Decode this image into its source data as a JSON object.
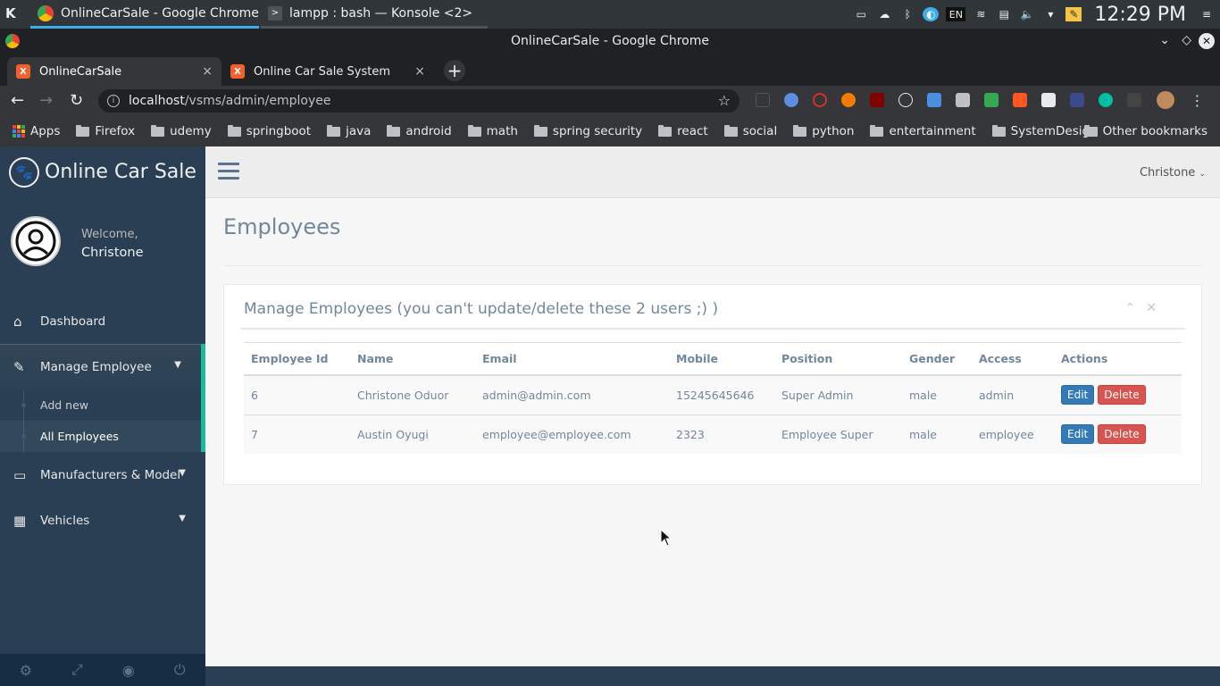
{
  "taskbar": {
    "tasks": [
      {
        "label": "OnlineCarSale - Google Chrome"
      },
      {
        "label": "lampp : bash — Konsole <2>"
      }
    ],
    "clock": "12:29 PM",
    "lang": "EN"
  },
  "window": {
    "title": "OnlineCarSale - Google Chrome"
  },
  "tabs": [
    {
      "label": "OnlineCarSale",
      "close": "×"
    },
    {
      "label": "Online Car Sale System",
      "close": "×"
    }
  ],
  "omnibox": {
    "host": "localhost",
    "path": "/vsms/admin/employee"
  },
  "bookmarks": {
    "apps": "Apps",
    "items": [
      "Firefox",
      "udemy",
      "springboot",
      "java",
      "android",
      "math",
      "spring security",
      "react",
      "social",
      "python",
      "entertainment",
      "SystemDesign"
    ],
    "other": "Other bookmarks"
  },
  "sidebar": {
    "brand": "Online Car Sale",
    "welcome": "Welcome,",
    "user": "Christone",
    "menu": [
      {
        "label": "Dashboard",
        "icon": "home-icon"
      },
      {
        "label": "Manage Employee",
        "icon": "edit-icon"
      },
      {
        "label": "Manufacturers & Model",
        "icon": "desktop-icon"
      },
      {
        "label": "Vehicles",
        "icon": "table-icon"
      }
    ],
    "submenu": [
      "Add new",
      "All Employees"
    ]
  },
  "topnav": {
    "user": "Christone"
  },
  "page": {
    "title": "Employees",
    "panel_title": "Manage Employees (you can't update/delete these 2 users ;) )"
  },
  "table": {
    "headers": [
      "Employee Id",
      "Name",
      "Email",
      "Mobile",
      "Position",
      "Gender",
      "Access",
      "Actions"
    ],
    "rows": [
      {
        "id": "6",
        "name": "Christone Oduor",
        "email": "admin@admin.com",
        "mobile": "15245645646",
        "position": "Super Admin",
        "gender": "male",
        "access": "admin"
      },
      {
        "id": "7",
        "name": "Austin Oyugi",
        "email": "employee@employee.com",
        "mobile": "2323",
        "position": "Employee Super",
        "gender": "male",
        "access": "employee"
      }
    ],
    "edit_label": "Edit",
    "delete_label": "Delete"
  }
}
